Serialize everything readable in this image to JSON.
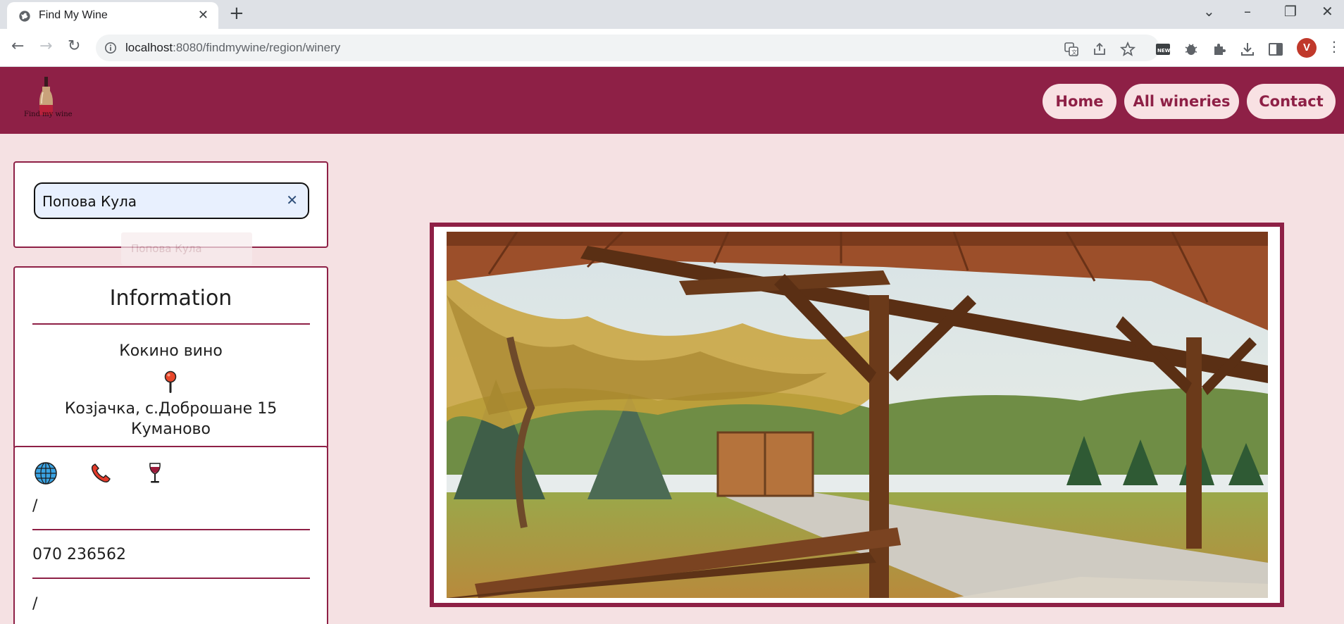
{
  "browser": {
    "tab_title": "Find My Wine",
    "url_host": "localhost",
    "url_path": ":8080/findmywine/region/winery"
  },
  "site": {
    "logo_text": "Find my wine",
    "nav": [
      {
        "label": "Home"
      },
      {
        "label": "All wineries"
      },
      {
        "label": "Contact"
      }
    ]
  },
  "search": {
    "value": "Попова Кула",
    "suggestion": "Попова Кула"
  },
  "info": {
    "title": "Information",
    "winery_name": "Кокино вино",
    "address_line1": "Козјачка, с.Доброшане 15",
    "address_line2": "Куманово"
  },
  "contact": {
    "website": "/",
    "phone": "070 236562",
    "wine": "/"
  },
  "colors": {
    "brand": "#8e2046",
    "page_bg": "#f5e1e3",
    "pill_bg": "#f8e1e3"
  }
}
